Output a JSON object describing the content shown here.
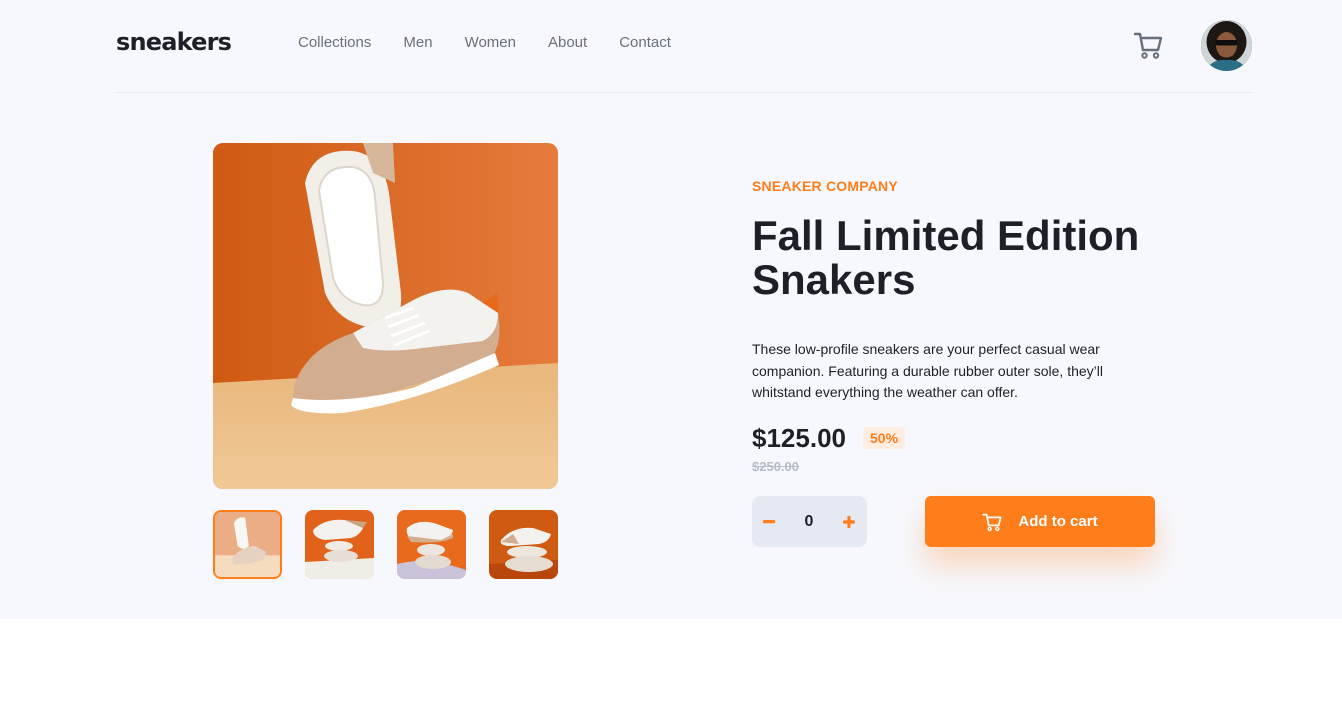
{
  "header": {
    "logo": "sneakers",
    "nav": [
      "Collections",
      "Men",
      "Women",
      "About",
      "Contact"
    ],
    "cart_icon": "cart-icon",
    "avatar_icon": "avatar"
  },
  "gallery": {
    "main_image": "sneaker-product-photo",
    "thumbnails": [
      "thumbnail-1",
      "thumbnail-2",
      "thumbnail-3",
      "thumbnail-4"
    ],
    "active_thumbnail": 0
  },
  "product": {
    "company": "SNEAKER COMPANY",
    "title": "Fall Limited Edition Snakers",
    "description": "These low-profile sneakers are your perfect casual wear companion. Featuring a durable rubber outer sole, they’ll whitstand everything the weather can offer.",
    "price": "$125.00",
    "discount": "50%",
    "original_price": "$250.00",
    "quantity": "0",
    "add_to_cart_label": "Add to cart"
  },
  "colors": {
    "accent": "#ff7d1a",
    "accent_pale": "#ffede0",
    "dark": "#1d2026",
    "grey": "#69707d",
    "light_grey": "#e4e9f2"
  }
}
